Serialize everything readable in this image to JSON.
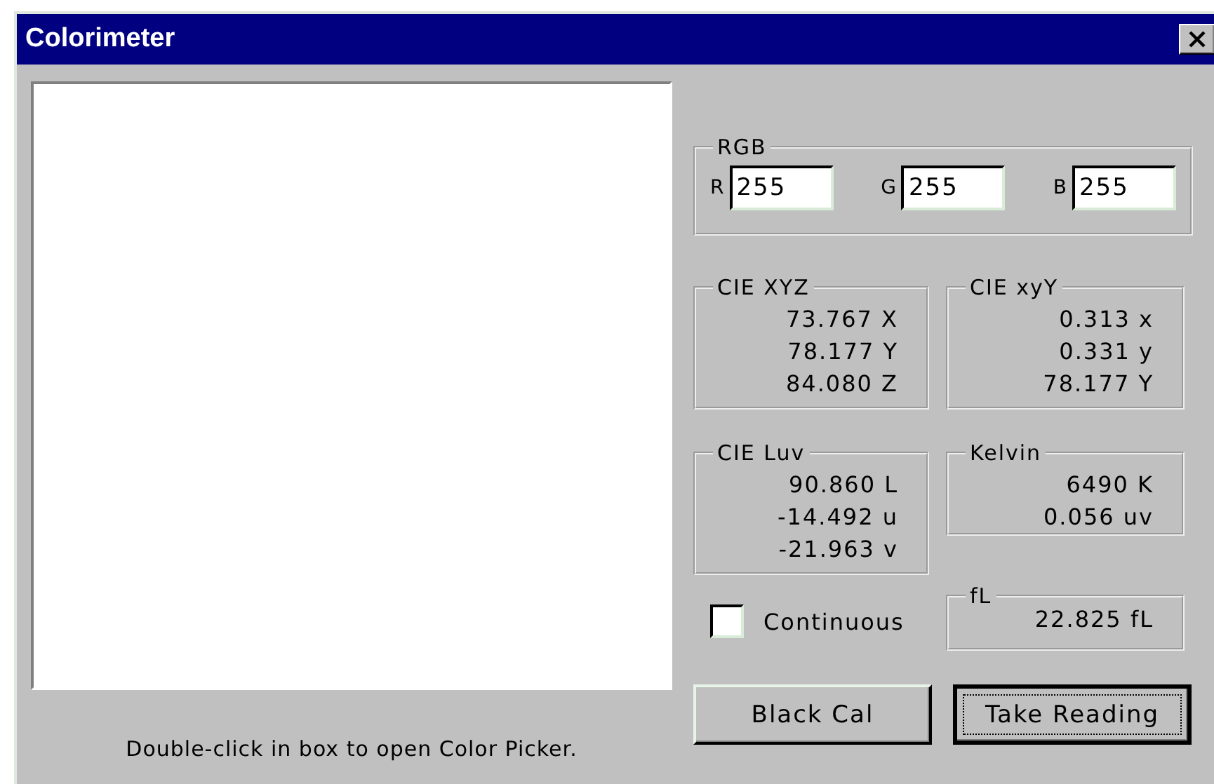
{
  "window": {
    "title": "Colorimeter"
  },
  "caption": "Double-click in box to open Color Picker.",
  "rgb": {
    "title": "RGB",
    "channels": [
      {
        "label": "R",
        "value": "255"
      },
      {
        "label": "G",
        "value": "255"
      },
      {
        "label": "B",
        "value": "255"
      }
    ]
  },
  "groups": [
    {
      "title": "CIE XYZ",
      "lines": [
        "73.767 X",
        "78.177 Y",
        "84.080 Z"
      ]
    },
    {
      "title": "CIE xyY",
      "lines": [
        "0.313 x",
        "0.331 y",
        "78.177 Y"
      ]
    },
    {
      "title": "CIE Luv",
      "lines": [
        "90.860 L",
        "-14.492 u",
        "-21.963 v"
      ]
    },
    {
      "title": "Kelvin",
      "lines": [
        "6490 K",
        "0.056 uv"
      ]
    }
  ],
  "continuous": {
    "label": "Continuous",
    "checked": false
  },
  "fl": {
    "title": "fL",
    "lines": [
      "22.825 fL"
    ]
  },
  "buttons": [
    {
      "label": "Black Cal",
      "default": false
    },
    {
      "label": "Take Reading",
      "default": true
    }
  ]
}
